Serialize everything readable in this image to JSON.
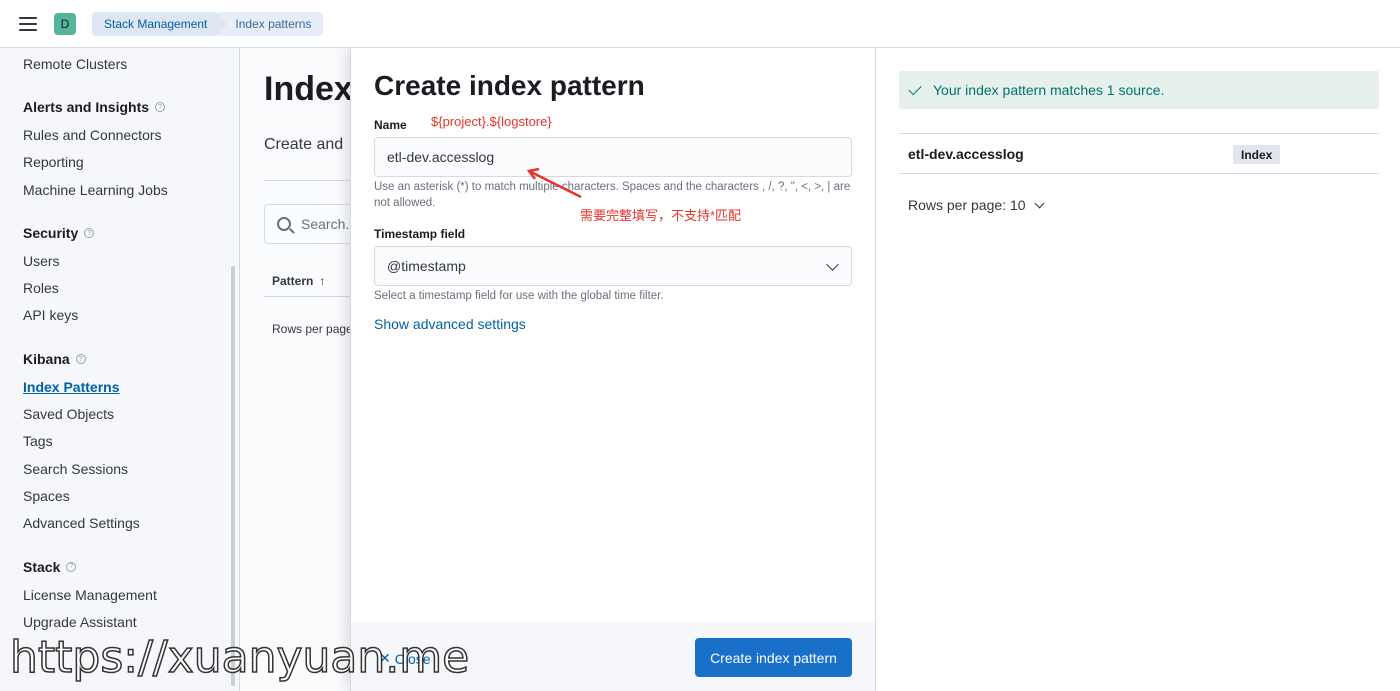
{
  "header": {
    "space_initial": "D",
    "breadcrumbs": [
      "Stack Management",
      "Index patterns"
    ]
  },
  "sidebar": {
    "top_item": "Remote Clusters",
    "groups": [
      {
        "title": "Alerts and Insights",
        "items": [
          "Rules and Connectors",
          "Reporting",
          "Machine Learning Jobs"
        ]
      },
      {
        "title": "Security",
        "items": [
          "Users",
          "Roles",
          "API keys"
        ]
      },
      {
        "title": "Kibana",
        "items": [
          "Index Patterns",
          "Saved Objects",
          "Tags",
          "Search Sessions",
          "Spaces",
          "Advanced Settings"
        ]
      },
      {
        "title": "Stack",
        "items": [
          "License Management",
          "Upgrade Assistant"
        ]
      }
    ],
    "active_item": "Index Patterns"
  },
  "page": {
    "title": "Index",
    "description": "Create and",
    "search_placeholder": "Search...",
    "column_pattern": "Pattern",
    "rows_per_page": "Rows per page"
  },
  "flyout": {
    "title": "Create index pattern",
    "name_label": "Name",
    "name_annotation": "${project}.${logstore}",
    "name_value": "etl-dev.accesslog",
    "name_help": "Use an asterisk (*) to match multiple characters. Spaces and the characters , /, ?, \", <, >, | are not allowed.",
    "name_note": "需要完整填写，不支持*匹配",
    "timestamp_label": "Timestamp field",
    "timestamp_value": "@timestamp",
    "timestamp_help": "Select a timestamp field for use with the global time filter.",
    "advanced_link": "Show advanced settings",
    "close_label": "Close",
    "create_button": "Create index pattern"
  },
  "preview": {
    "callout": "Your index pattern matches 1 source.",
    "rows": [
      {
        "name": "etl-dev.accesslog",
        "type": "Index"
      }
    ],
    "rows_per_page": "Rows per page: 10"
  },
  "watermark": "https://xuanyuan.me"
}
